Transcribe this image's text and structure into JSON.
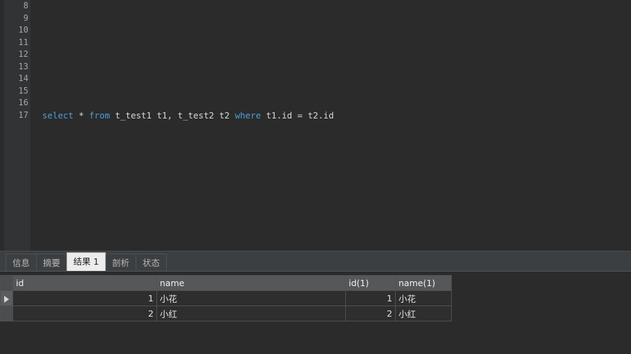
{
  "editor": {
    "line_numbers": [
      "8",
      "9",
      "10",
      "11",
      "12",
      "13",
      "14",
      "15",
      "16",
      "17"
    ],
    "lines": [
      {
        "num": "8",
        "tokens": []
      },
      {
        "num": "9",
        "tokens": []
      },
      {
        "num": "10",
        "tokens": []
      },
      {
        "num": "11",
        "tokens": []
      },
      {
        "num": "12",
        "tokens": []
      },
      {
        "num": "13",
        "tokens": []
      },
      {
        "num": "14",
        "tokens": []
      },
      {
        "num": "15",
        "tokens": []
      },
      {
        "num": "16",
        "tokens": []
      },
      {
        "num": "17",
        "tokens": [
          {
            "t": "select",
            "c": "kw"
          },
          {
            "t": " ",
            "c": "plain"
          },
          {
            "t": "*",
            "c": "op"
          },
          {
            "t": " ",
            "c": "plain"
          },
          {
            "t": "from",
            "c": "kw"
          },
          {
            "t": " t_test1 t1, t_test2 t2 ",
            "c": "plain"
          },
          {
            "t": "where",
            "c": "kw"
          },
          {
            "t": " t1.id = t2.id",
            "c": "plain"
          }
        ]
      }
    ],
    "sql_text": "select * from t_test1 t1, t_test2 t2 where t1.id = t2.id"
  },
  "bottom_panel": {
    "tabs": [
      {
        "label": "信息",
        "count": "",
        "active": false
      },
      {
        "label": "摘要",
        "count": "",
        "active": false
      },
      {
        "label": "结果",
        "count": "1",
        "active": true
      },
      {
        "label": "剖析",
        "count": "",
        "active": false
      },
      {
        "label": "状态",
        "count": "",
        "active": false
      }
    ],
    "grid": {
      "columns": [
        "id",
        "name",
        "id(1)",
        "name(1)"
      ],
      "rows": [
        {
          "selected": true,
          "cells": [
            "1",
            "小花",
            "1",
            "小花"
          ]
        },
        {
          "selected": false,
          "cells": [
            "2",
            "小红",
            "2",
            "小红"
          ]
        }
      ]
    }
  },
  "colors": {
    "editor_bg": "#2b2b2b",
    "gutter_bg": "#313335",
    "keyword": "#4c9fd5",
    "text": "#d8d8d8",
    "panel_bg": "#3c3f41",
    "grid_header": "#555759",
    "active_tab": "#ececec"
  }
}
